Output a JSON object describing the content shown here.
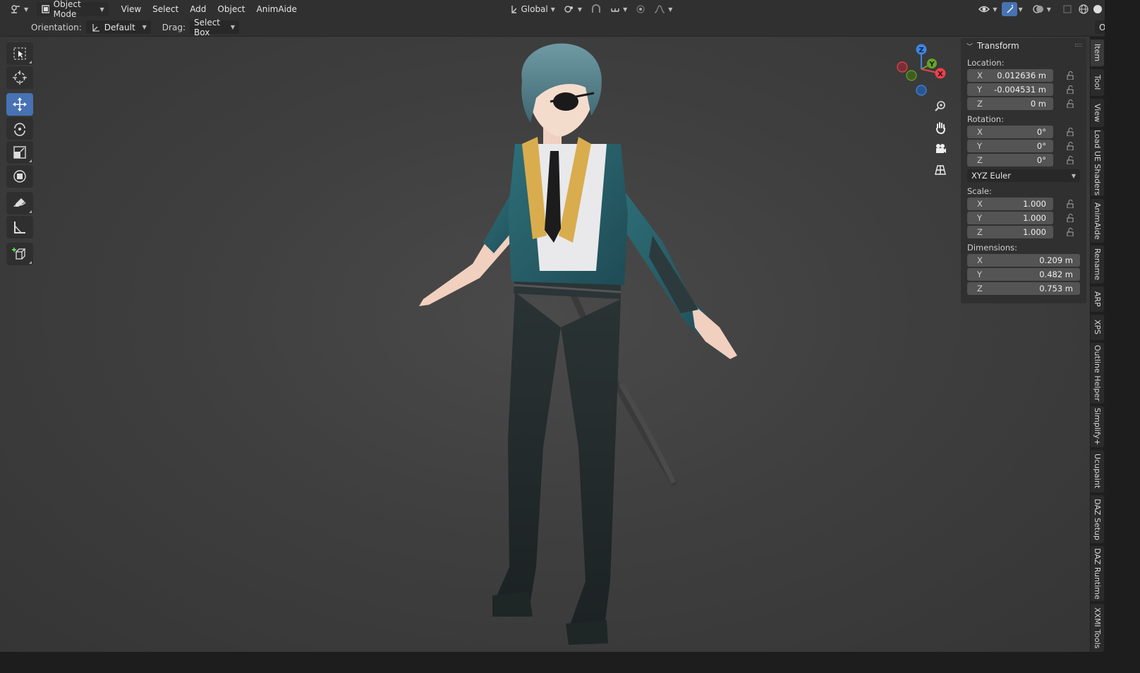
{
  "header": {
    "mode": "Object Mode",
    "menus": [
      "View",
      "Select",
      "Add",
      "Object",
      "AnimAide"
    ],
    "transform_orientation": "Global"
  },
  "tool_settings": {
    "orientation_label": "Orientation:",
    "orientation_value": "Default",
    "drag_label": "Drag:",
    "drag_value": "Select Box",
    "options_label": "Options"
  },
  "toolbar": {
    "tools": [
      "select-box",
      "cursor",
      "move",
      "rotate",
      "scale",
      "transform",
      "annotate",
      "measure",
      "add-cube"
    ],
    "active_tool": "move"
  },
  "gizmo": {
    "axes": [
      "X",
      "Y",
      "Z"
    ]
  },
  "transform_panel": {
    "title": "Transform",
    "location_label": "Location:",
    "location": {
      "x": "0.012636 m",
      "y": "-0.004531 m",
      "z": "0 m"
    },
    "rotation_label": "Rotation:",
    "rotation": {
      "x": "0°",
      "y": "0°",
      "z": "0°"
    },
    "rotation_mode": "XYZ Euler",
    "scale_label": "Scale:",
    "scale": {
      "x": "1.000",
      "y": "1.000",
      "z": "1.000"
    },
    "dimensions_label": "Dimensions:",
    "dimensions": {
      "x": "0.209 m",
      "y": "0.482 m",
      "z": "0.753 m"
    },
    "axis_labels": {
      "x": "X",
      "y": "Y",
      "z": "Z"
    }
  },
  "sidebar_tabs": [
    "Item",
    "Tool",
    "View",
    "Load UE Shaders",
    "AnimAide",
    "Rename",
    "ARP",
    "XPS",
    "Outline Helper",
    "Simplify+",
    "Ucupaint",
    "DAZ Setup",
    "DAZ Runtime",
    "XXMI Tools"
  ],
  "colors": {
    "accent": "#4772b3",
    "axis_x": "#e8424d",
    "axis_y": "#6aa12a",
    "axis_z": "#3d86e0"
  }
}
